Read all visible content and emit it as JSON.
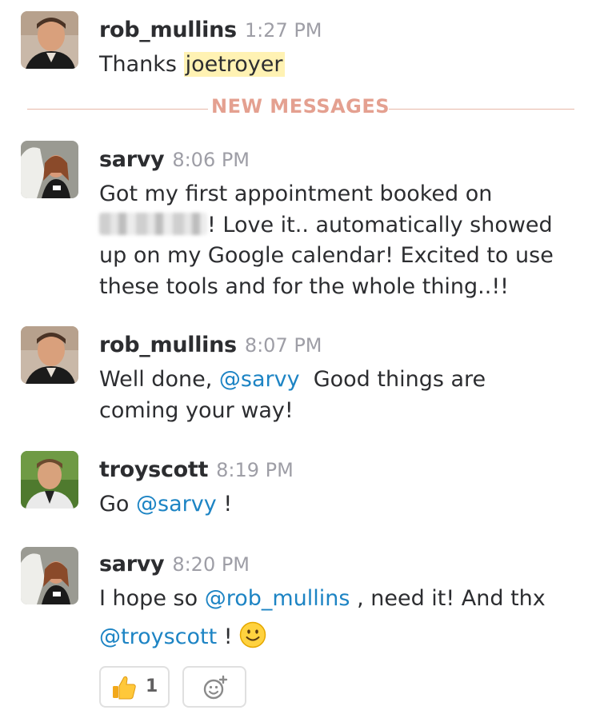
{
  "divider_label": "NEW MESSAGES",
  "messages": [
    {
      "user": "rob_mullins",
      "time": "1:27 PM",
      "avatar": "rob-avatar",
      "lines": [
        "Thanks",
        "joetroyer"
      ]
    },
    {
      "user": "sarvy",
      "time": "8:06 PM",
      "avatar": "sarvy-avatar",
      "lines": [
        "Got my first appointment booked on",
        "! Love it.. automatically showed",
        "up on my Google calendar! Excited to use",
        "these tools and for the whole thing..!!"
      ]
    },
    {
      "user": "rob_mullins",
      "time": "8:07 PM",
      "avatar": "rob-avatar",
      "lines": [
        "Well done,",
        "@sarvy",
        "Good things are",
        "coming your way!"
      ]
    },
    {
      "user": "troyscott",
      "time": "8:19 PM",
      "avatar": "troy-avatar",
      "lines": [
        "Go",
        "@sarvy",
        "!"
      ]
    },
    {
      "user": "sarvy",
      "time": "8:20 PM",
      "avatar": "sarvy-avatar",
      "lines": [
        "I hope so",
        "@rob_mullins",
        ", need it! And thx",
        "@troyscott",
        "!"
      ]
    }
  ],
  "reactions": [
    {
      "emoji": "thumbs-up-icon",
      "count": "1"
    },
    {
      "emoji": "add-reaction-icon"
    }
  ],
  "colors": {
    "mention": "#1d84c4",
    "highlight": "#fff2b3",
    "divider": "#e4a090",
    "timestamp": "#9e9ea6"
  }
}
